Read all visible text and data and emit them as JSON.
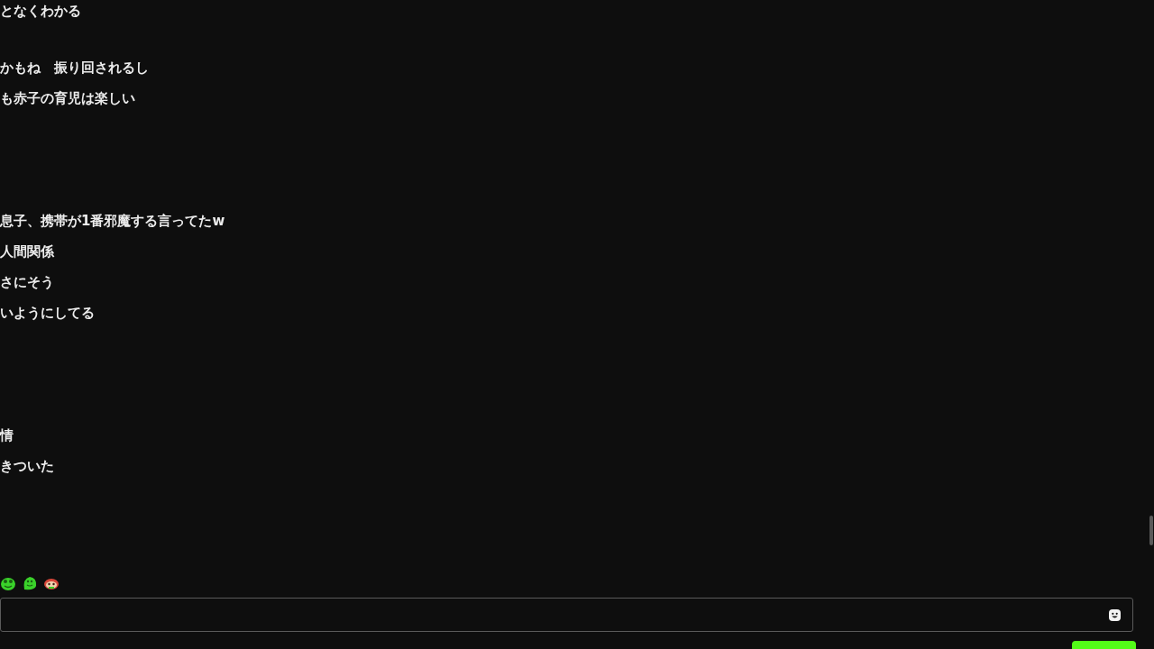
{
  "chat": {
    "messages": [
      {
        "kind": "text",
        "text": "となくわかる"
      },
      {
        "kind": "text",
        "text": "かもね　振り回されるし"
      },
      {
        "kind": "text",
        "text": "も赤子の育児は楽しい"
      },
      {
        "kind": "text",
        "text": "息子、携帯が1番邪魔する言ってたw"
      },
      {
        "kind": "text",
        "text": "人間関係"
      },
      {
        "kind": "text",
        "text": "さにそう"
      },
      {
        "kind": "text",
        "text": "いようにしてる"
      },
      {
        "kind": "text",
        "text": "情"
      },
      {
        "kind": "text",
        "text": "きついた"
      }
    ],
    "emotes": [
      {
        "kind": "frog"
      },
      {
        "kind": "blob"
      },
      {
        "kind": "monkey"
      }
    ]
  },
  "composer": {
    "kind": "input"
  }
}
